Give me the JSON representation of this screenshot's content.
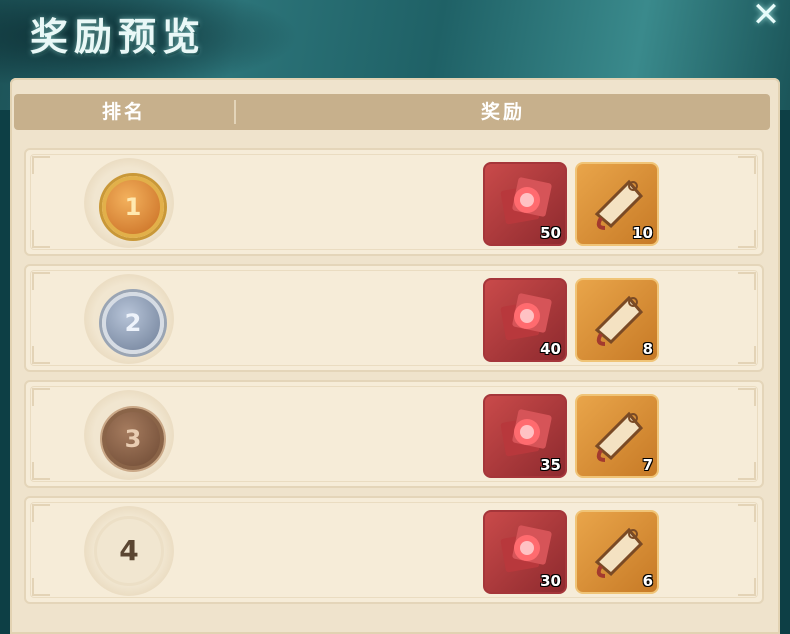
{
  "title": "奖励预览",
  "header": {
    "rank_label": "排名",
    "reward_label": "奖励"
  },
  "rows": [
    {
      "rank": "1",
      "rewards": [
        {
          "icon": "red-gem-item-icon",
          "count": "50"
        },
        {
          "icon": "token-plaque-item-icon",
          "count": "10"
        }
      ]
    },
    {
      "rank": "2",
      "rewards": [
        {
          "icon": "red-gem-item-icon",
          "count": "40"
        },
        {
          "icon": "token-plaque-item-icon",
          "count": "8"
        }
      ]
    },
    {
      "rank": "3",
      "rewards": [
        {
          "icon": "red-gem-item-icon",
          "count": "35"
        },
        {
          "icon": "token-plaque-item-icon",
          "count": "7"
        }
      ]
    },
    {
      "rank": "4",
      "rewards": [
        {
          "icon": "red-gem-item-icon",
          "count": "30"
        },
        {
          "icon": "token-plaque-item-icon",
          "count": "6"
        }
      ]
    }
  ],
  "colors": {
    "panel": "#efe3cc",
    "header": "#c7b08c",
    "accent_teal": "#2c7479",
    "red_item": "#c94a4a",
    "orange_item": "#e9a54a"
  }
}
